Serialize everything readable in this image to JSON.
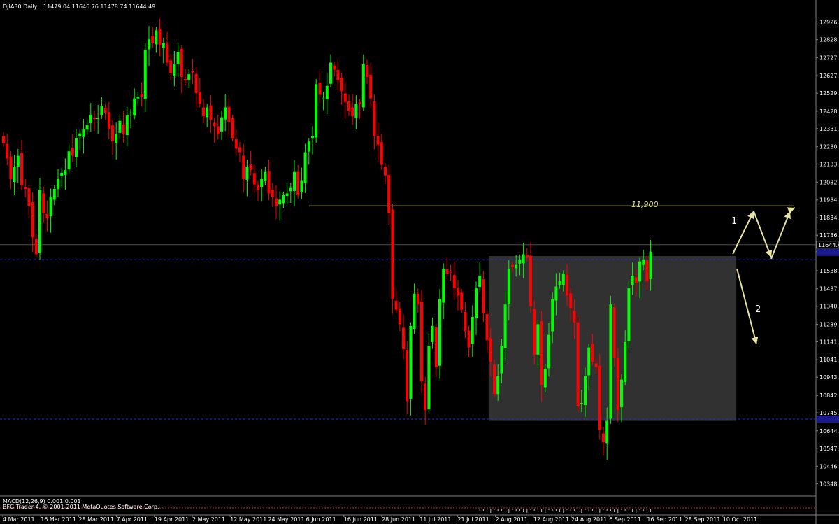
{
  "header": {
    "symbol": "DJIA30,Daily",
    "ohlc": "11479.04 11646.76 11478.74 11644.49"
  },
  "indicator_label": "MACD(12,26,9) 0.001 0.001",
  "copyright": "BFG Trader 4, © 2001-2011 MetaQuotes Software Corp.",
  "colors": {
    "background": "#000000",
    "bull": "#00ff00",
    "bear": "#ff0000",
    "grid_frame": "#808080",
    "level_line": "#e8e4a0",
    "dotted_levels": "#2233cc",
    "range_box": "#3a3a3a"
  },
  "annotations": {
    "level_label": "11,900",
    "scenario_1": "1",
    "scenario_2": "2"
  },
  "chart_data": {
    "type": "candlestick",
    "timeframe": "Daily",
    "ylim": [
      10300,
      13030
    ],
    "y_ticks": [
      "12926.55",
      "12828.23",
      "12727.09",
      "12627.62",
      "12529.50",
      "12428.98",
      "12331.34",
      "12230.61",
      "12133.36",
      "12032.81",
      "11934.01",
      "11834.27",
      "11736.40",
      "11644.49",
      "11538.32",
      "11437.61",
      "11340.03",
      "11239.41",
      "11141.88",
      "11041.84",
      "10943.59",
      "10842.04",
      "10745.34",
      "10644.62",
      "10547.02",
      "10446.11",
      "10348.45"
    ],
    "current_price": "11644.49",
    "current_price_value": 11644.49,
    "x_ticks": [
      "4 Mar 2011",
      "16 Mar 2011",
      "28 Mar 2011",
      "7 Apr 2011",
      "19 Apr 2011",
      "2 May 2011",
      "12 May 2011",
      "24 May 2011",
      "6 Jun 2011",
      "16 Jun 2011",
      "28 Jun 2011",
      "11 Jul 2011",
      "21 Jul 2011",
      "2 Aug 2011",
      "12 Aug 2011",
      "24 Aug 2011",
      "6 Sep 2011",
      "16 Sep 2011",
      "28 Sep 2011",
      "10 Oct 2011"
    ],
    "horizontal_levels": [
      {
        "label": "11,900",
        "value": 11900
      },
      {
        "label": "",
        "value": 11600
      },
      {
        "label": "",
        "value": 10710
      }
    ],
    "range_box": {
      "from_bar": 134,
      "to_bar": 201,
      "low": 10700,
      "high": 11620
    },
    "closes": [
      12250,
      12165,
      12050,
      12120,
      12180,
      12015,
      11995,
      11900,
      11725,
      11630,
      11990,
      11860,
      11830,
      11950,
      11995,
      12050,
      12085,
      12100,
      12205,
      12180,
      12280,
      12305,
      12330,
      12350,
      12410,
      12385,
      12390,
      12460,
      12420,
      12330,
      12260,
      12300,
      12375,
      12300,
      12405,
      12420,
      12500,
      12510,
      12510,
      12770,
      12830,
      12810,
      12880,
      12800,
      12810,
      12700,
      12640,
      12690,
      12760,
      12620,
      12600,
      12635,
      12645,
      12530,
      12470,
      12400,
      12450,
      12380,
      12345,
      12300,
      12395,
      12450,
      12370,
      12280,
      12220,
      12200,
      12050,
      12120,
      12100,
      12020,
      11990,
      12050,
      12090,
      11970,
      11950,
      11900,
      11935,
      11960,
      11970,
      12000,
      12090,
      11960,
      12040,
      12200,
      12260,
      12290,
      12580,
      12520,
      12500,
      12570,
      12700,
      12660,
      12600,
      12540,
      12480,
      12430,
      12400,
      12470,
      12470,
      12690,
      12620,
      12500,
      12290,
      12240,
      12130,
      12070,
      11860,
      11380,
      11320,
      11240,
      11100,
      10810,
      11230,
      11410,
      11350,
      10920,
      10760,
      11120,
      11230,
      11000,
      11380,
      11550,
      11520,
      11530,
      11440,
      11400,
      11320,
      11200,
      11110,
      11280,
      11440,
      11510,
      11300,
      11150,
      11030,
      10850,
      10950,
      11120,
      11350,
      11550,
      11560,
      11570,
      11600,
      11630,
      11610,
      11340,
      11070,
      11240,
      10900,
      10990,
      11180,
      11380,
      11450,
      11480,
      11520,
      11400,
      11330,
      11250,
      10780,
      10800,
      10950,
      11110,
      11030,
      11000,
      10650,
      10580,
      10700,
      11350,
      11050,
      10760,
      10930,
      11140,
      11440,
      11510,
      11470,
      11590,
      11600,
      11480,
      11644.49
    ]
  }
}
